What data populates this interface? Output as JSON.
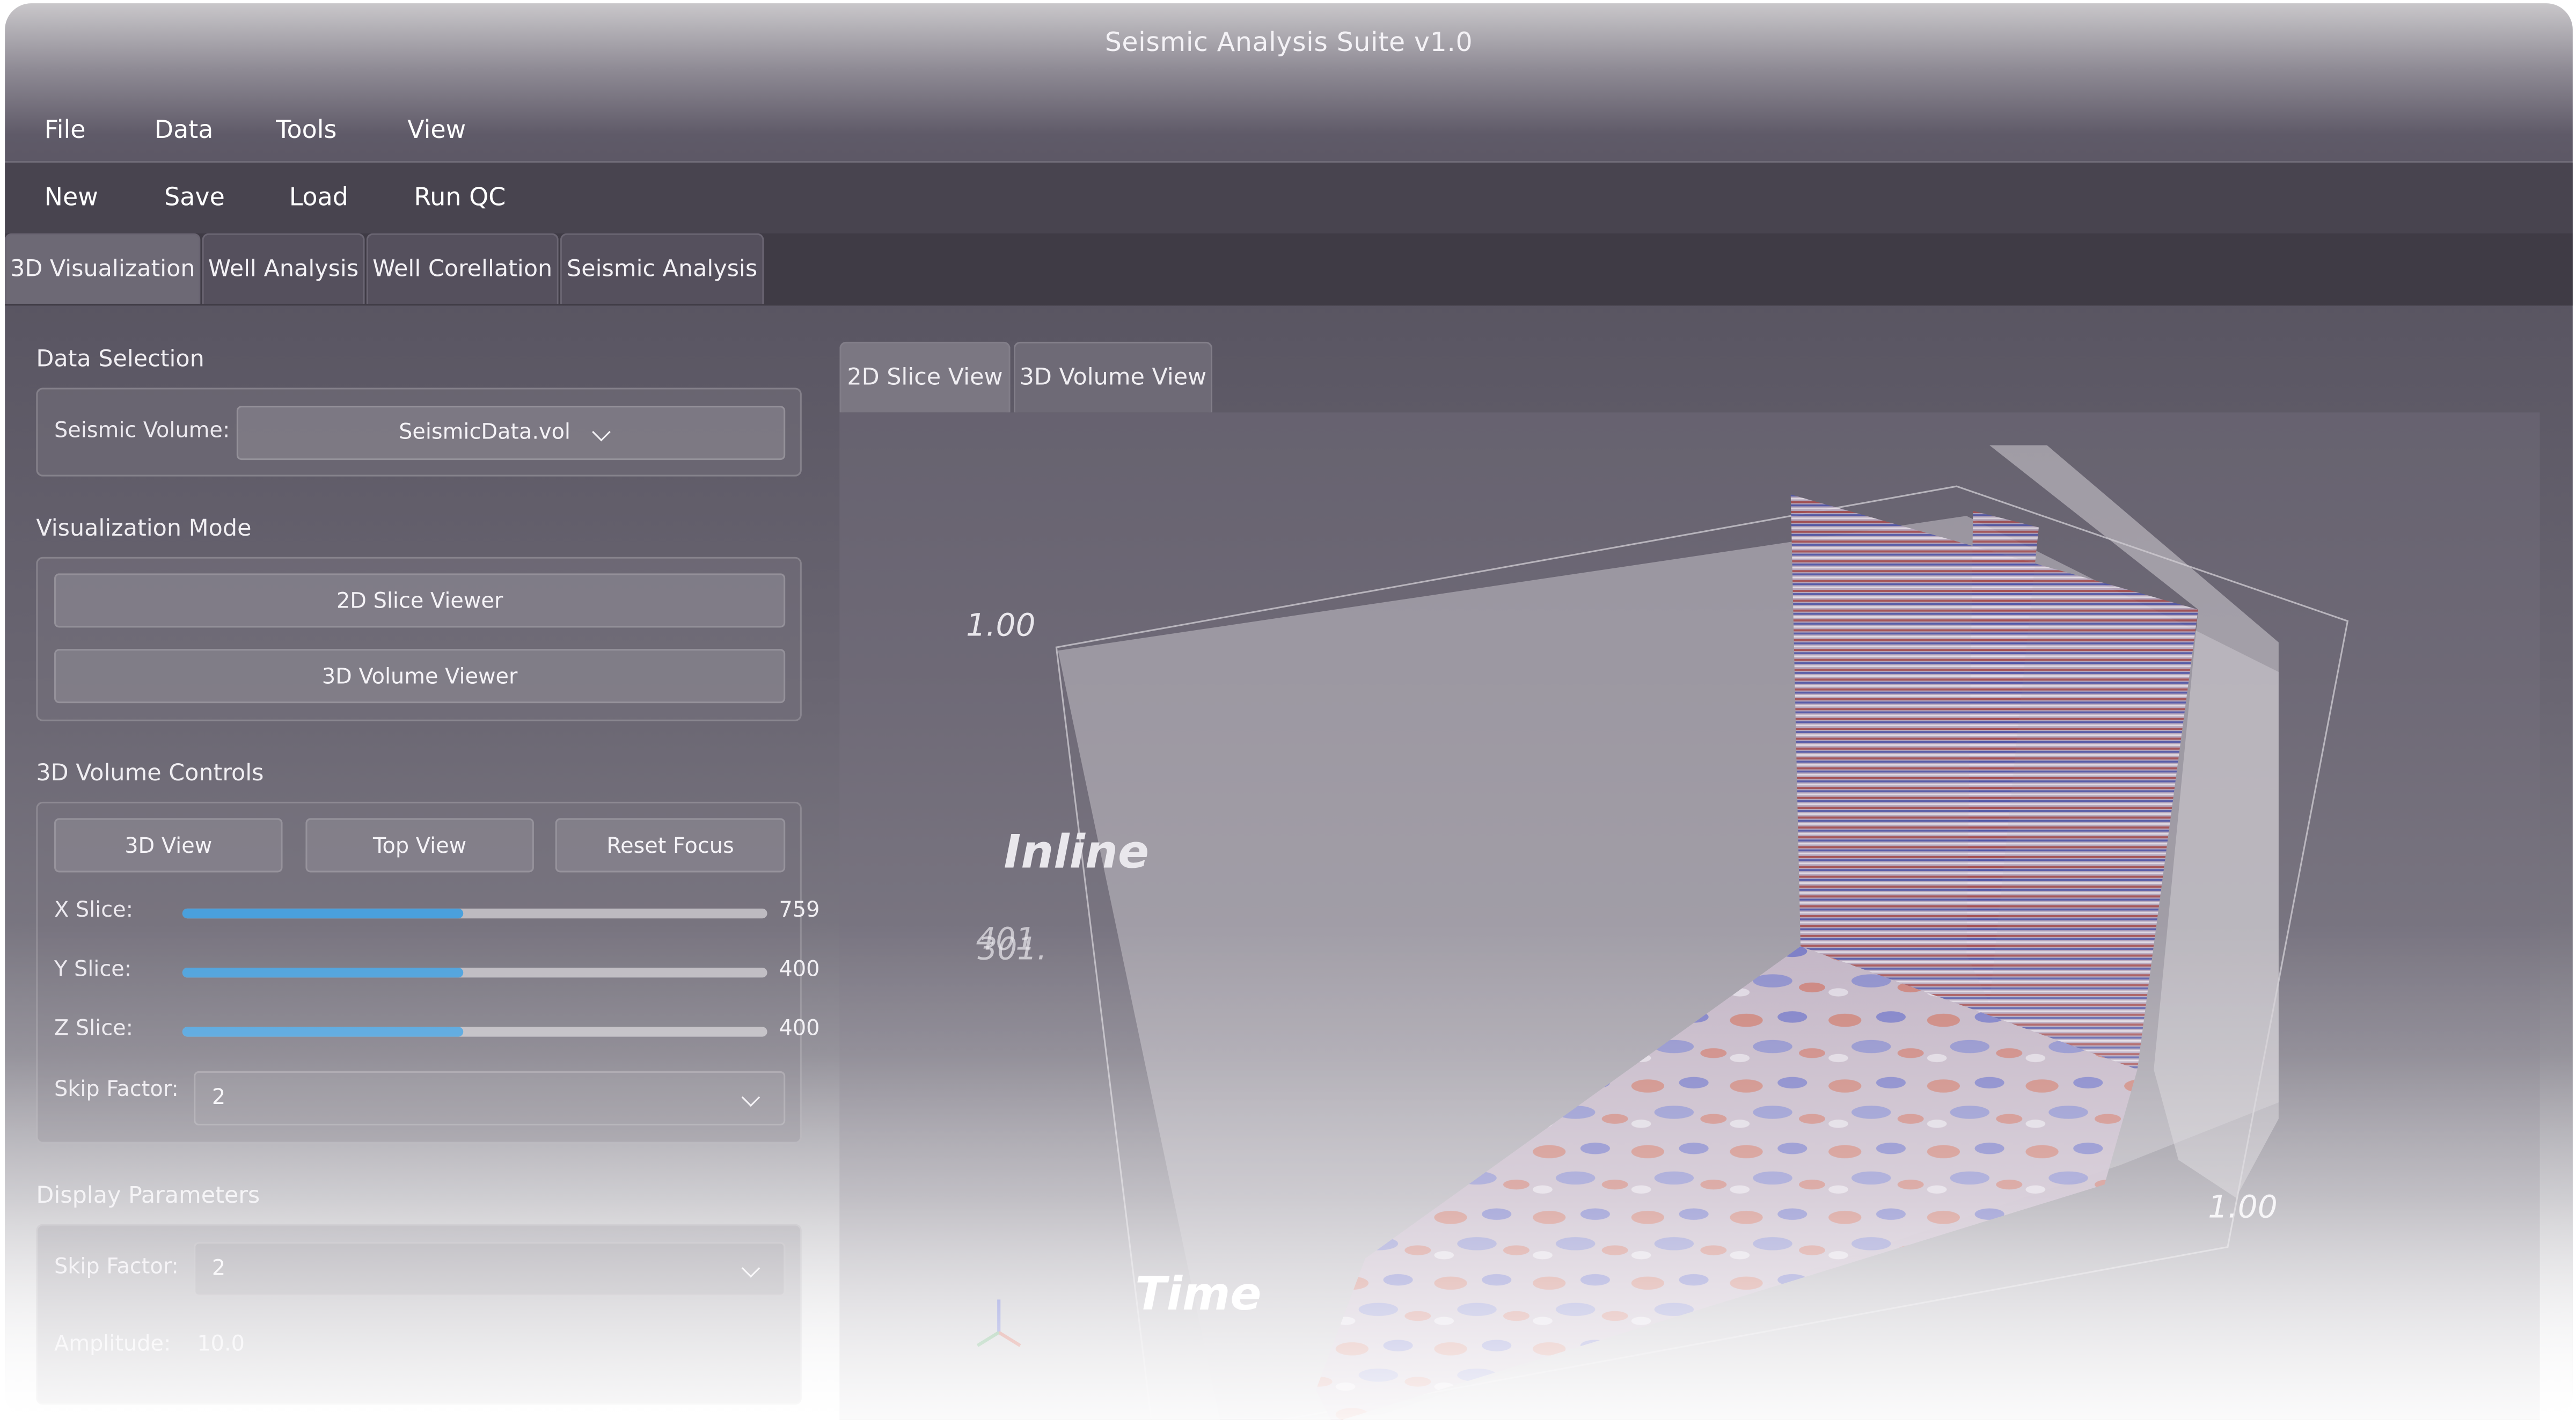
{
  "window": {
    "title": "Seismic Analysis Suite v1.0"
  },
  "menubar": {
    "items": [
      "File",
      "Data",
      "Tools",
      "View"
    ]
  },
  "toolbar": {
    "items": [
      "New",
      "Save",
      "Load",
      "Run QC"
    ]
  },
  "tabs": {
    "items": [
      "3D Visualization",
      "Well Analysis",
      "Well Corellation",
      "Seismic Analysis"
    ],
    "active": "3D Visualization"
  },
  "data_selection": {
    "heading": "Data Selection",
    "seismic_volume_label": "Seismic Volume:",
    "seismic_volume_value": "SeismicData.vol"
  },
  "visualization_mode": {
    "heading": "Visualization Mode",
    "buttons": [
      "2D Slice Viewer",
      "3D Volume Viewer"
    ]
  },
  "volume_controls": {
    "heading": "3D Volume Controls",
    "buttons": [
      "3D View",
      "Top View",
      "Reset Focus"
    ],
    "sliders": [
      {
        "label": "X Slice:",
        "value": "759",
        "fill": 0.48
      },
      {
        "label": "Y Slice:",
        "value": "400",
        "fill": 0.48
      },
      {
        "label": "Z Slice:",
        "value": "400",
        "fill": 0.48
      }
    ],
    "skip_factor_label": "Skip Factor:",
    "skip_factor_value": "2"
  },
  "display_parameters": {
    "heading": "Display Parameters",
    "skip_factor_label": "Skip Factor:",
    "skip_factor_value": "2",
    "amplitude_label": "Amplitude:",
    "amplitude_value": "10.0"
  },
  "viewer": {
    "tabs": [
      "2D Slice View",
      "3D Volume View"
    ],
    "active_tab": "2D Slice View",
    "axis_labels": {
      "inline": "Inline",
      "time": "Time"
    },
    "tick_labels": {
      "top_left": "1.00",
      "mid_left_a": "401",
      "mid_left_b": "301.",
      "bottom_right": "1.00"
    },
    "colors": {
      "accent": "#4aa0dc",
      "seismic_red": "#c8584a",
      "seismic_blue": "#5a63c8"
    }
  }
}
